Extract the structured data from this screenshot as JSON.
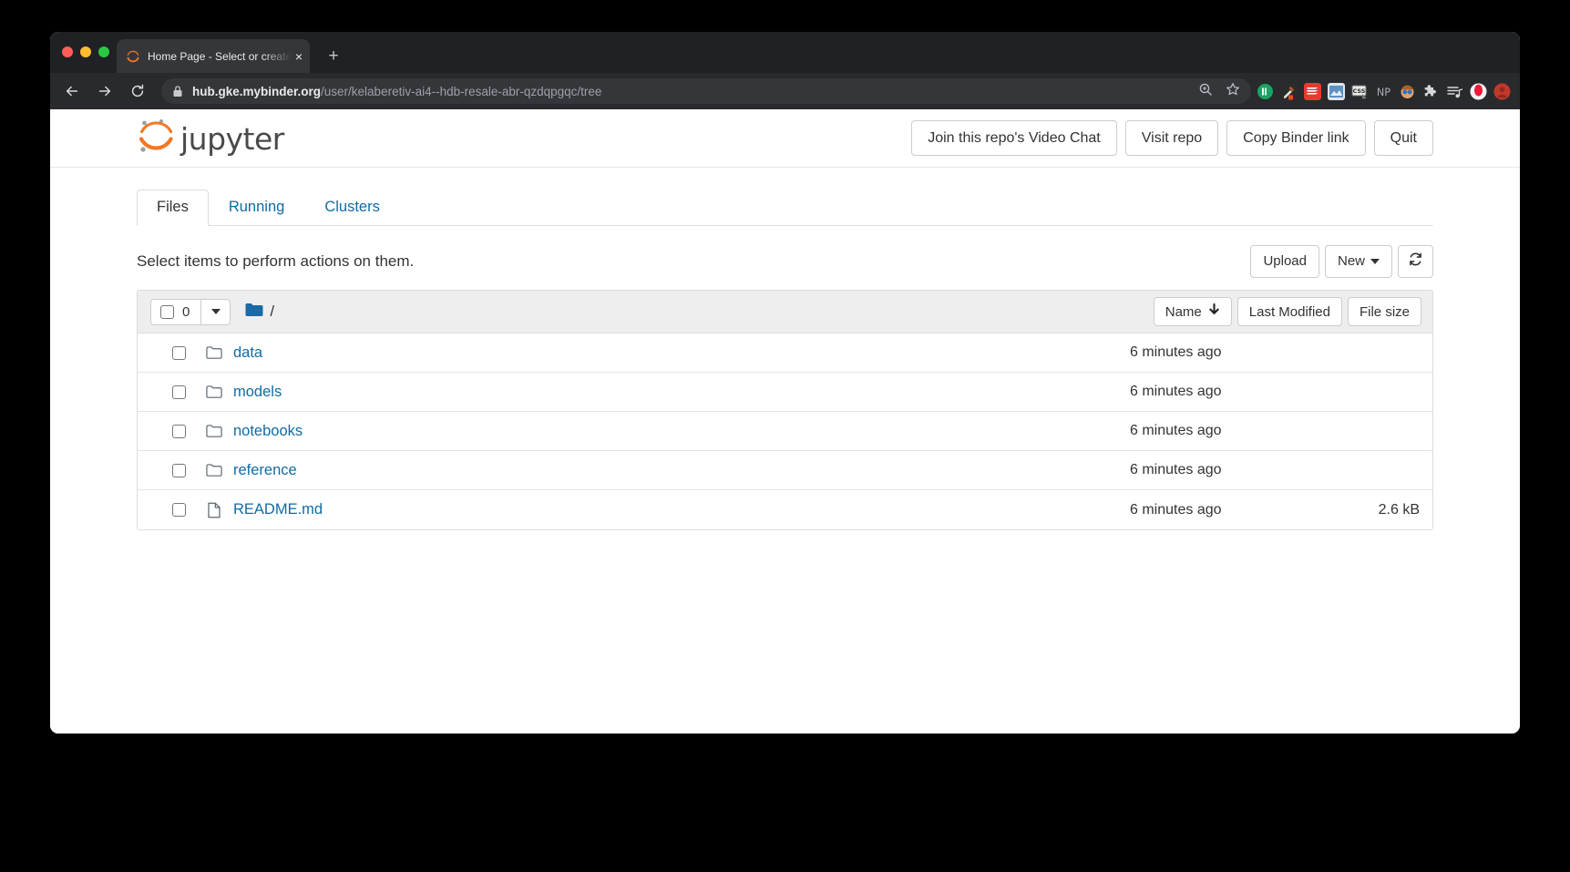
{
  "browser": {
    "tab_title": "Home Page - Select or create a",
    "tab_favicon_name": "jupyter-favicon",
    "new_tab_label": "+",
    "close_label": "×",
    "url_host": "hub.gke.mybinder.org",
    "url_path": "/user/kelaberetiv-ai4--hdb-resale-abr-qzdqpgqc/tree",
    "nav": {
      "back_label": "back-arrow",
      "forward_label": "forward-arrow",
      "reload_label": "reload"
    },
    "omnibox_icons": [
      "zoom-icon",
      "bookmark-star-icon"
    ],
    "extensions": [
      {
        "name": "pushbullet-extension-icon",
        "label": "",
        "color": "#19a463"
      },
      {
        "name": "eyedropper-extension-icon",
        "label": "",
        "color": "#3a3a3a"
      },
      {
        "name": "sumo-extension-icon",
        "label": "",
        "color": "#e8392f"
      },
      {
        "name": "image-tools-extension-icon",
        "label": "",
        "color": "#4b7fb5"
      },
      {
        "name": "css-extension-icon",
        "label": "CSS",
        "color": "#d8d8d8"
      },
      {
        "name": "np-extension-icon",
        "label": "NP",
        "color": "#a9adb3"
      },
      {
        "name": "avatar-extension-icon",
        "label": "",
        "color": "#e2a170"
      },
      {
        "name": "puzzle-extensions-icon",
        "label": "",
        "color": "#d6d7da"
      },
      {
        "name": "playlist-extension-icon",
        "label": "",
        "color": "#d6d7da"
      },
      {
        "name": "opera-profile-icon",
        "label": "",
        "color": "#ec1b3a"
      },
      {
        "name": "user-profile-icon",
        "label": "",
        "color": "#c0392b"
      }
    ]
  },
  "jupyter": {
    "logo_text": "jupyter",
    "logo_color": "#f37726",
    "header_buttons": [
      {
        "name": "join-video-chat-button",
        "label": "Join this repo's Video Chat"
      },
      {
        "name": "visit-repo-button",
        "label": "Visit repo"
      },
      {
        "name": "copy-binder-link-button",
        "label": "Copy Binder link"
      },
      {
        "name": "quit-button",
        "label": "Quit"
      }
    ],
    "tabs": [
      {
        "name": "tab-files",
        "label": "Files",
        "active": true
      },
      {
        "name": "tab-running",
        "label": "Running",
        "active": false
      },
      {
        "name": "tab-clusters",
        "label": "Clusters",
        "active": false
      }
    ],
    "select_hint": "Select items to perform actions on them.",
    "actions": {
      "upload_label": "Upload",
      "new_label": "New",
      "refresh_label": "refresh-icon"
    },
    "list_header": {
      "selected_count": "0",
      "breadcrumb_path": "/",
      "sort_name_label": "Name",
      "sort_name_arrow": "↓",
      "sort_modified_label": "Last Modified",
      "sort_size_label": "File size"
    },
    "files": [
      {
        "name": "data",
        "type": "folder",
        "modified": "6 minutes ago",
        "size": ""
      },
      {
        "name": "models",
        "type": "folder",
        "modified": "6 minutes ago",
        "size": ""
      },
      {
        "name": "notebooks",
        "type": "folder",
        "modified": "6 minutes ago",
        "size": ""
      },
      {
        "name": "reference",
        "type": "folder",
        "modified": "6 minutes ago",
        "size": ""
      },
      {
        "name": "README.md",
        "type": "file",
        "modified": "6 minutes ago",
        "size": "2.6 kB"
      }
    ]
  },
  "colors": {
    "link": "#106ba3",
    "accent": "#f37726",
    "folder_blue": "#1a6aa8"
  }
}
